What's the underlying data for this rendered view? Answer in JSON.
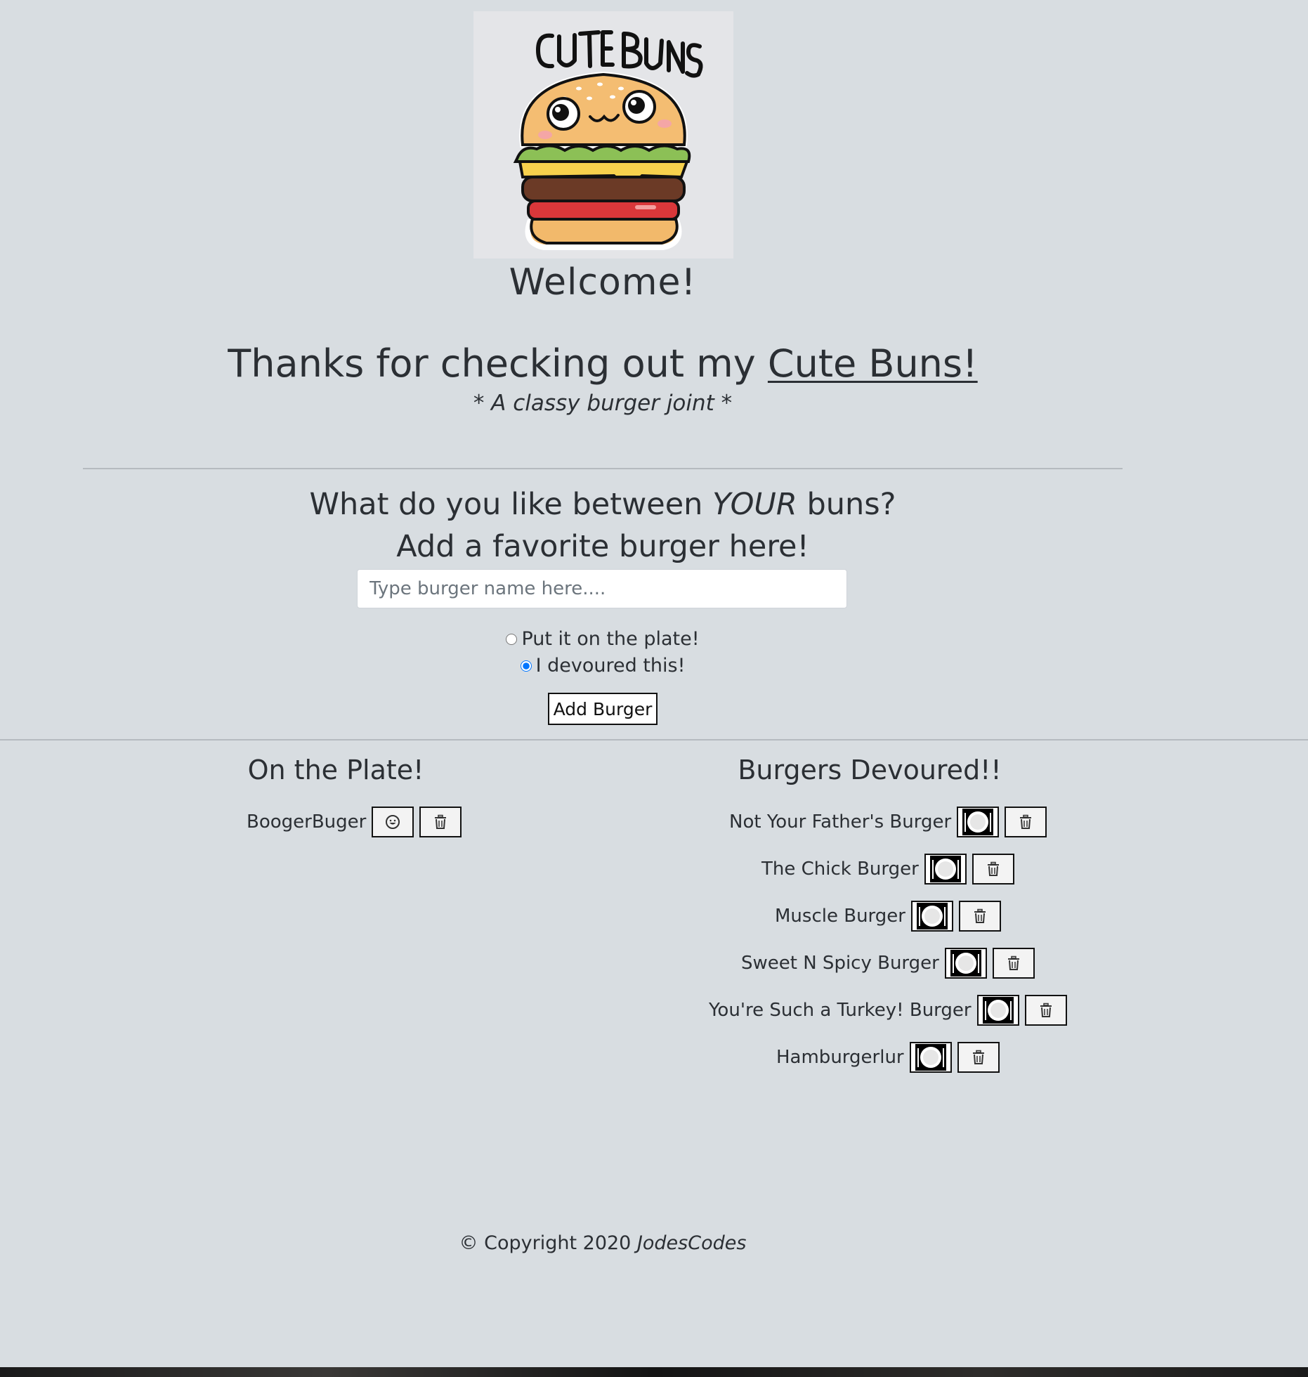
{
  "logo": {
    "alt_text": "CUTE BUNS"
  },
  "header": {
    "welcome": "Welcome!",
    "thanks_prefix": "Thanks for checking out my ",
    "thanks_link": "Cute Buns!",
    "tagline": "* A classy burger joint *"
  },
  "form": {
    "question_prefix": "What do you like between ",
    "question_emphasis": "YOUR",
    "question_suffix": " buns?",
    "prompt": "Add a favorite burger here!",
    "input_placeholder": "Type burger name here....",
    "input_value": "",
    "radio_plate_label": "Put it on the plate!",
    "radio_devoured_label": "I devoured this!",
    "selected_radio": "devoured",
    "submit_label": "Add Burger"
  },
  "plate": {
    "title": "On the Plate!",
    "items": [
      "BoogerBuger"
    ]
  },
  "devoured": {
    "title": "Burgers Devoured!!",
    "items": [
      "Not Your Father's Burger",
      "The Chick Burger",
      "Muscle Burger",
      "Sweet N Spicy Burger",
      "You're Such a Turkey! Burger",
      "Hamburgerlur"
    ]
  },
  "footer": {
    "copyright": "© Copyright 2020 ",
    "author": "JodesCodes"
  },
  "colors": {
    "background": "#d8dde1",
    "text": "#2b2f34",
    "radio_accent": "#2f6fe0"
  }
}
